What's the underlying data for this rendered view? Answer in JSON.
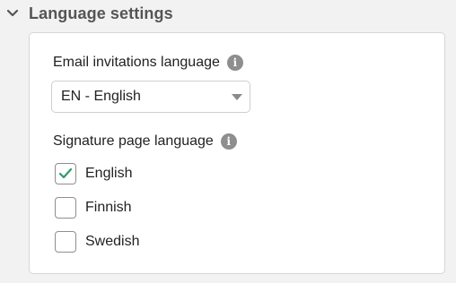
{
  "section": {
    "title": "Language settings",
    "expanded": true
  },
  "email_language": {
    "label": "Email invitations language",
    "info_icon": "info-icon",
    "selected": "EN - English"
  },
  "signature_language": {
    "label": "Signature page language",
    "info_icon": "info-icon",
    "options": [
      {
        "label": "English",
        "checked": true
      },
      {
        "label": "Finnish",
        "checked": false
      },
      {
        "label": "Swedish",
        "checked": false
      }
    ]
  },
  "colors": {
    "check_accent": "#2f9a6c",
    "info_icon": "#8e8e8e",
    "header_text": "#555555"
  }
}
